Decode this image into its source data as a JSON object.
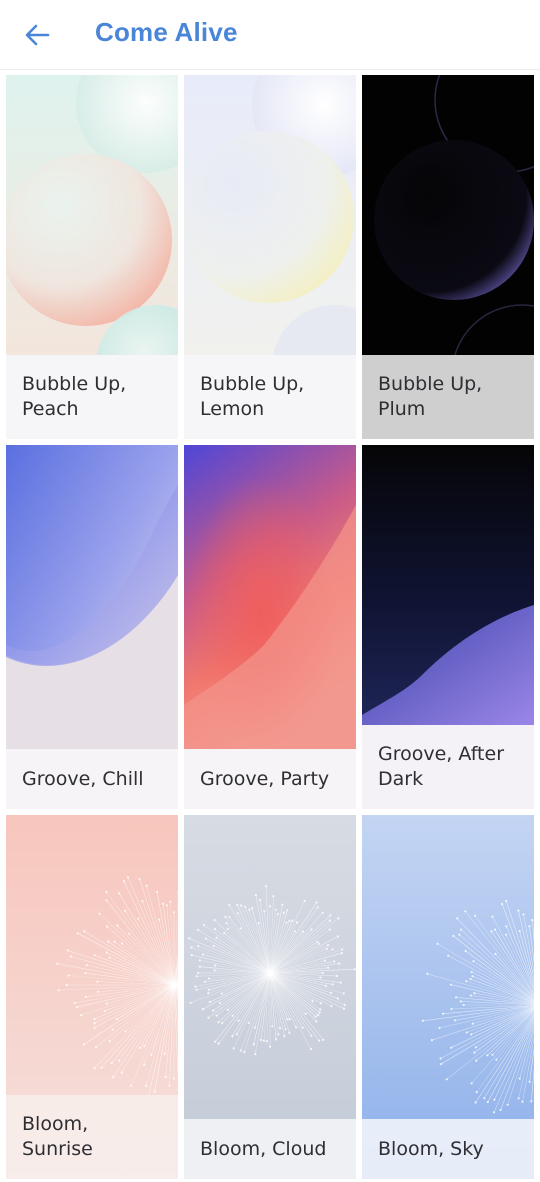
{
  "header": {
    "back_icon": "arrow-left-icon",
    "title": "Come Alive"
  },
  "colors": {
    "accent": "#4a86d8",
    "label_bg_light": "#f5f5f7",
    "label_bg_plum": "#cfcfcf"
  },
  "wallpapers": [
    {
      "label": "Bubble Up,\nPeach",
      "style": "bubble-peach"
    },
    {
      "label": "Bubble Up,\nLemon",
      "style": "bubble-lemon"
    },
    {
      "label": "Bubble Up,\nPlum",
      "style": "bubble-plum"
    },
    {
      "label": "Groove, Chill",
      "style": "groove-chill"
    },
    {
      "label": "Groove, Party",
      "style": "groove-party"
    },
    {
      "label": "Groove, After\nDark",
      "style": "groove-dark"
    },
    {
      "label": "Bloom,\nSunrise",
      "style": "bloom-sunrise"
    },
    {
      "label": "Bloom, Cloud",
      "style": "bloom-cloud"
    },
    {
      "label": "Bloom, Sky",
      "style": "bloom-sky"
    }
  ]
}
